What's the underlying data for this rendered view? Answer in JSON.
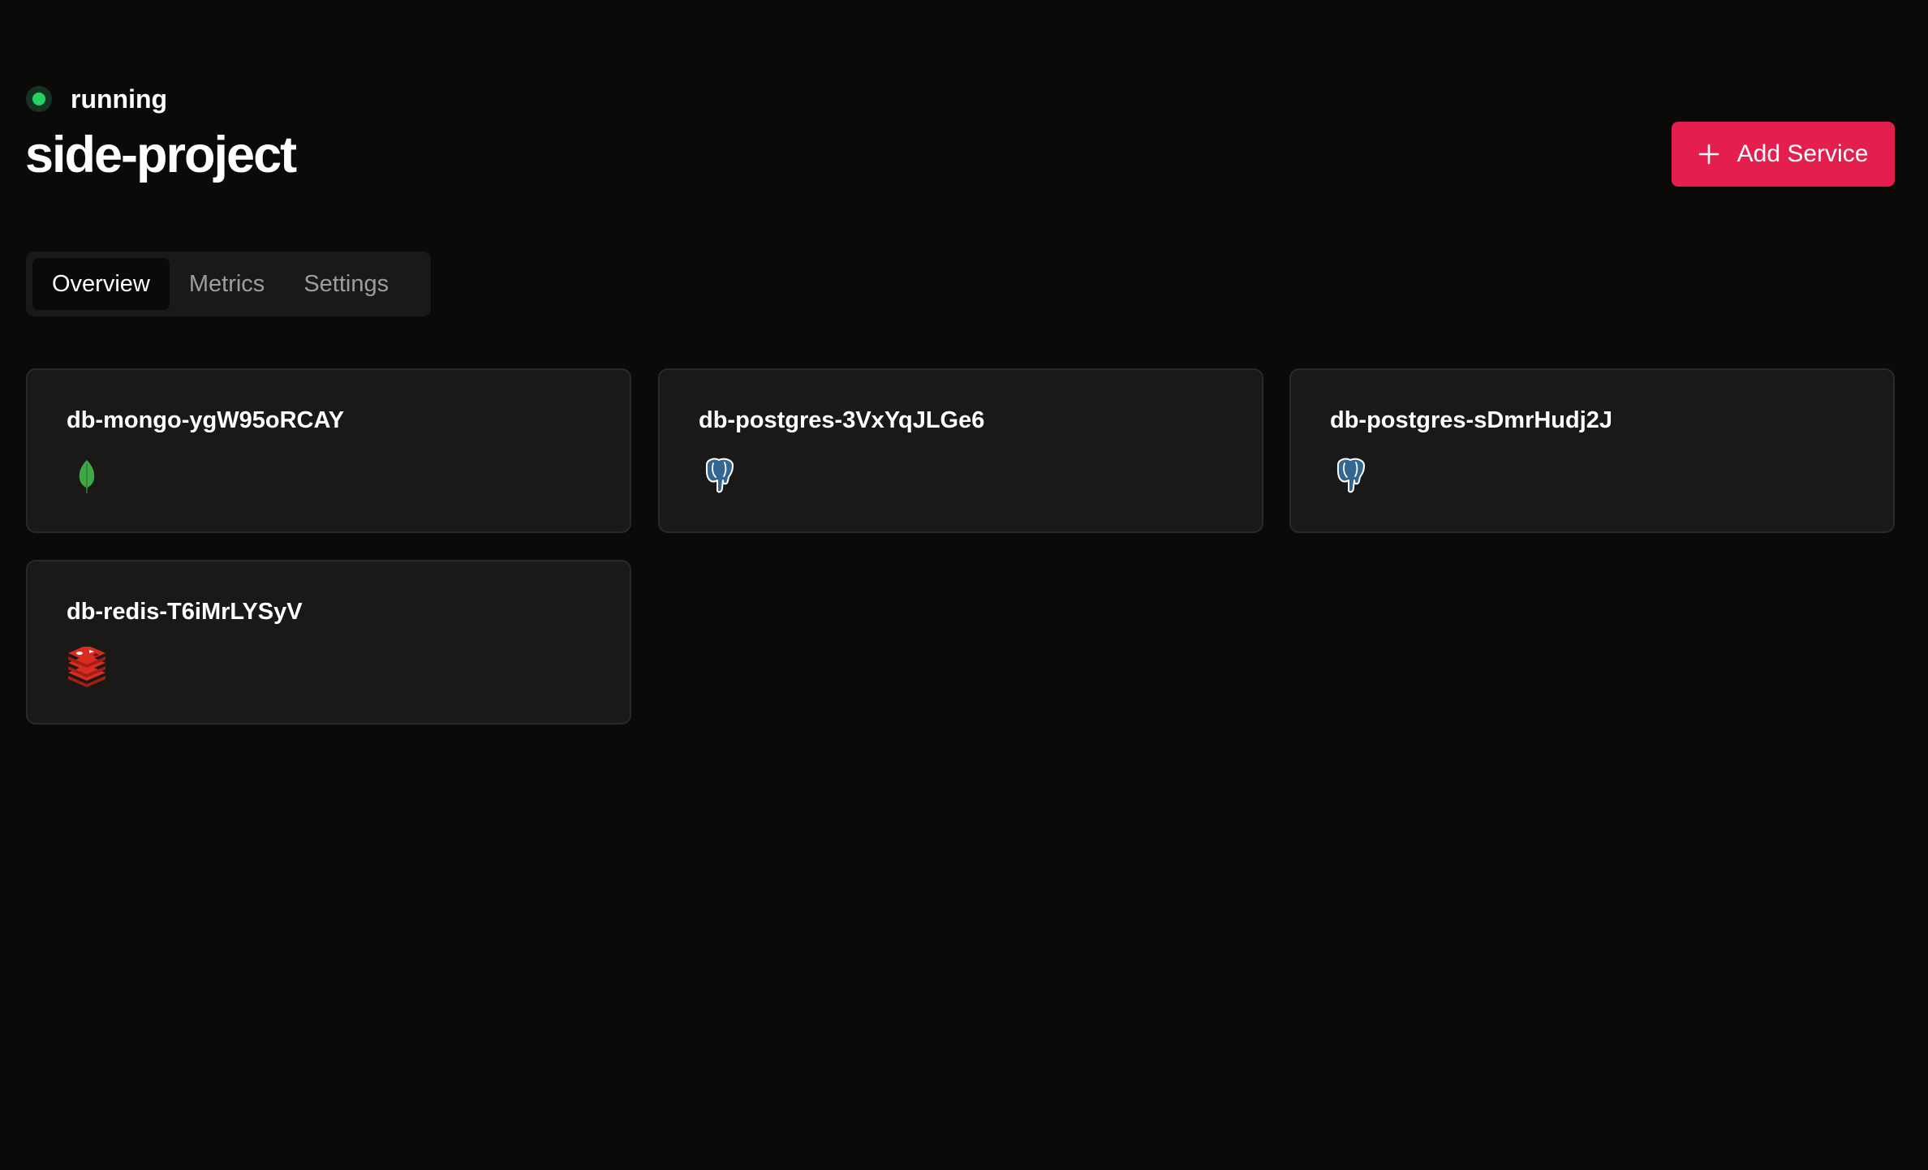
{
  "project": {
    "status": "running",
    "status_color": "#22d362",
    "name": "side-project"
  },
  "actions": {
    "add_service_label": "Add Service",
    "accent_color": "#e41f4e"
  },
  "tabs": [
    {
      "label": "Overview",
      "active": true
    },
    {
      "label": "Metrics",
      "active": false
    },
    {
      "label": "Settings",
      "active": false
    }
  ],
  "services": [
    {
      "name": "db-mongo-ygW95oRCAY",
      "icon": "mongodb-leaf-icon"
    },
    {
      "name": "db-postgres-3VxYqJLGe6",
      "icon": "postgres-elephant-icon"
    },
    {
      "name": "db-postgres-sDmrHudj2J",
      "icon": "postgres-elephant-icon"
    },
    {
      "name": "db-redis-T6iMrLYSyV",
      "icon": "redis-stack-icon"
    }
  ]
}
